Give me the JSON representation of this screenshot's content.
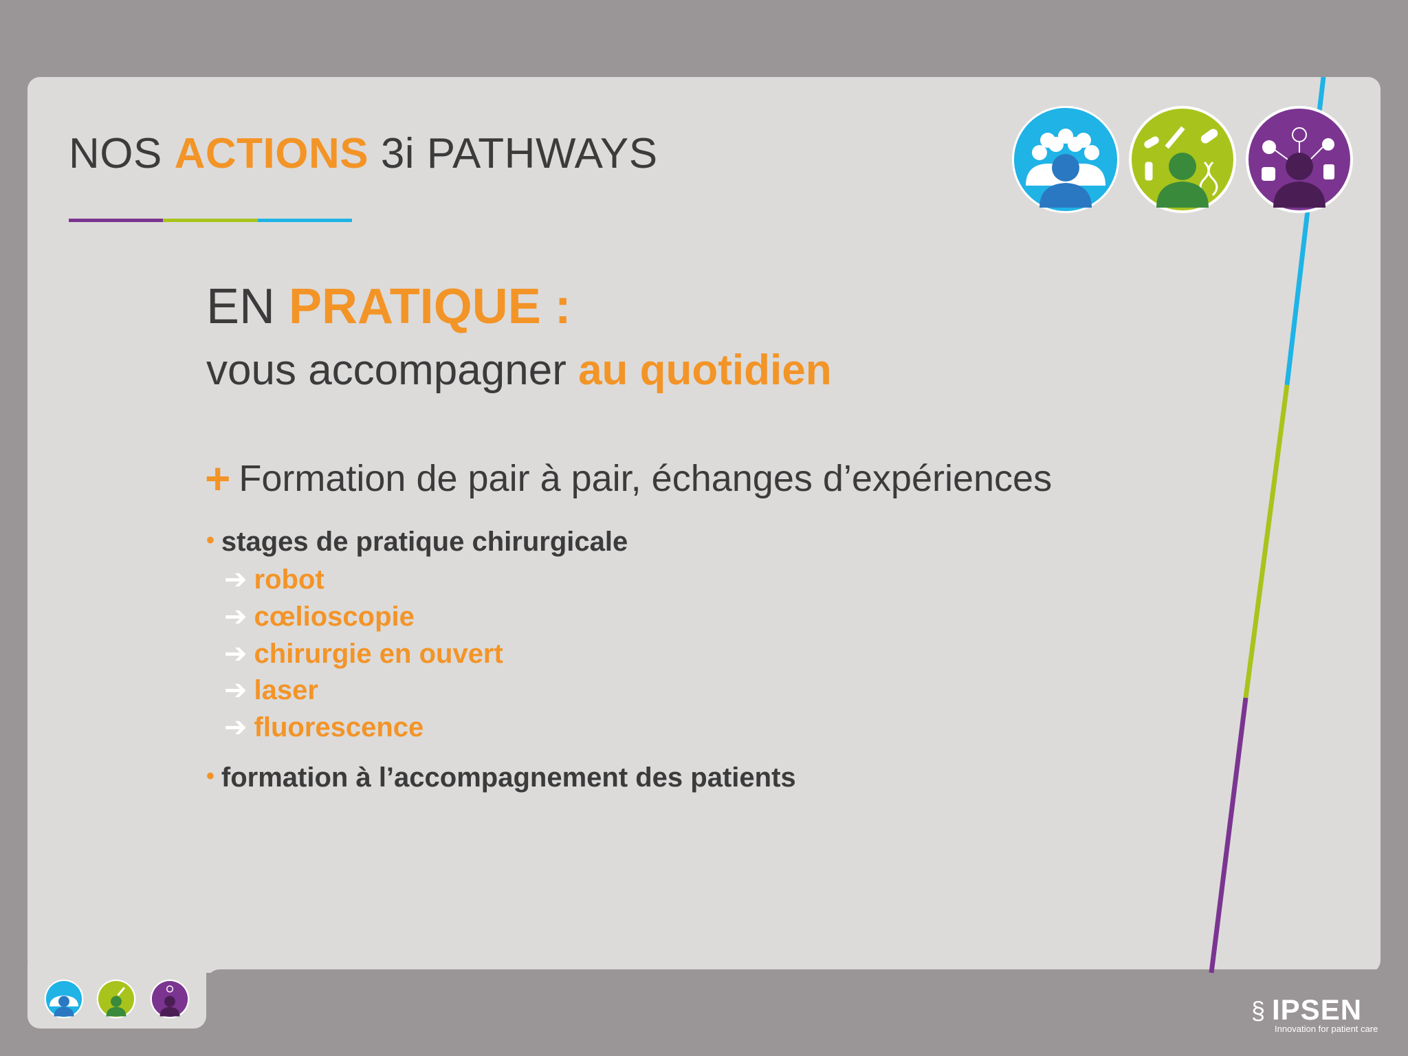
{
  "header": {
    "title_prefix": "NOS ",
    "title_accent": "ACTIONS",
    "title_suffix": " 3i PATHWAYS"
  },
  "section": {
    "heading_prefix": "EN ",
    "heading_accent": "PRATIQUE :",
    "subheading_prefix": "vous accompagner ",
    "subheading_accent": "au quotidien",
    "plus_symbol": "+",
    "topic": "Formation de pair à pair, échanges d’expériences"
  },
  "bullets": [
    {
      "dot": "•",
      "text": "stages de pratique chirurgicale",
      "items": [
        {
          "arrow": "➔",
          "text": "robot"
        },
        {
          "arrow": "➔",
          "text": "cœlioscopie"
        },
        {
          "arrow": "➔",
          "text": "chirurgie en ouvert"
        },
        {
          "arrow": "➔",
          "text": "laser"
        },
        {
          "arrow": "➔",
          "text": "fluorescence"
        }
      ]
    },
    {
      "dot": "•",
      "text": "formation à l’accompagnement des patients",
      "items": []
    }
  ],
  "icons": [
    "people-group-icon",
    "medical-tools-icon",
    "healthcare-network-icon"
  ],
  "logo": {
    "mark": "§",
    "brand": "IPSEN",
    "tagline": "Innovation for patient care"
  },
  "colors": {
    "orange": "#f39427",
    "purple": "#7b3590",
    "green": "#a8c41c",
    "blue": "#1fb3e6",
    "text": "#3c3b3c",
    "panel": "#dcdbda",
    "background": "#9a9596"
  }
}
